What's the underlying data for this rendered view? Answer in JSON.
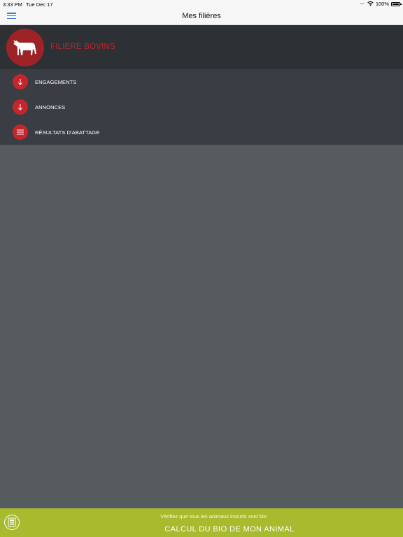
{
  "status_bar": {
    "time": "3:33 PM",
    "date": "Tue Dec 17",
    "battery": "100%",
    "wifi_icon": "wifi-icon",
    "battery_icon": "battery-icon"
  },
  "nav": {
    "title": "Mes filières",
    "menu_icon": "hamburger-menu-icon"
  },
  "section": {
    "title": "FILIERE BOVINS",
    "icon": "cow-icon"
  },
  "menu": {
    "items": [
      {
        "label": "ENGAGEMENTS",
        "icon": "arrow-down-icon"
      },
      {
        "label": "ANNONCES",
        "icon": "arrow-down-icon"
      },
      {
        "label": "RÉSULTATS D'ABATTAGE",
        "icon": "list-icon"
      }
    ]
  },
  "footer": {
    "subtitle": "Vérifiez que tous les animaux inscrits sont bio",
    "cta": "CALCUL DU BIO DE MON ANIMAL",
    "icon": "calculator-icon"
  },
  "colors": {
    "accent_red": "#c4262c",
    "footer_green": "#a8bb2e",
    "header_dark": "#2d3034",
    "menu_bg": "#3a3e44",
    "content_bg": "#565b5f",
    "nav_blue": "#3d7ccf"
  }
}
